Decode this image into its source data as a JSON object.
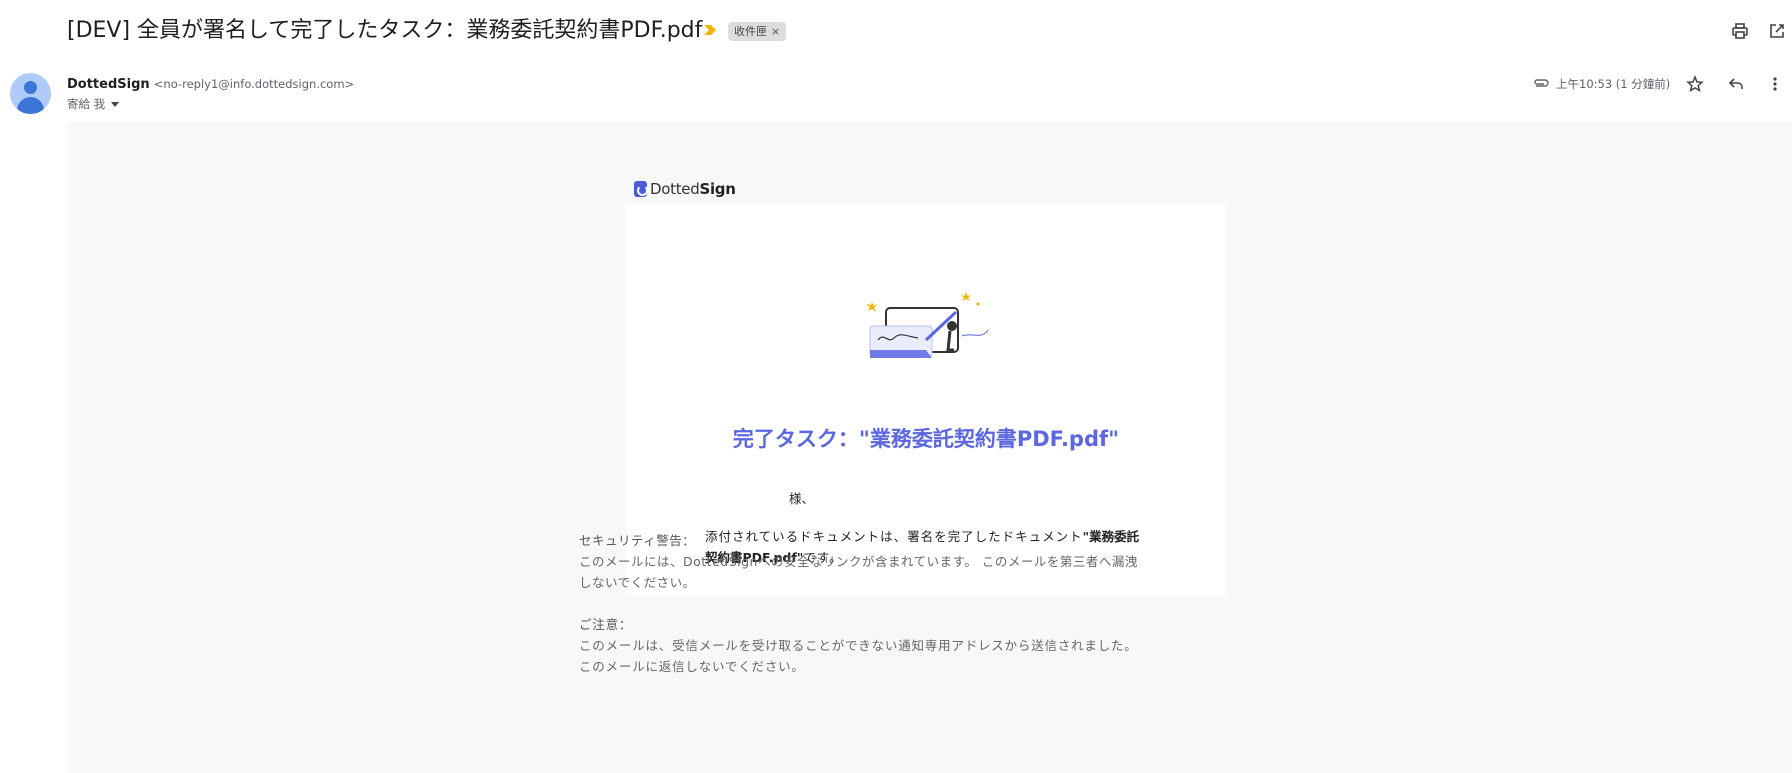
{
  "email": {
    "subject": "[DEV] 全員が署名して完了したタスク：業務委託契約書PDF.pdf",
    "label": "收件匣",
    "label_remove": "×",
    "sender_name": "DottedSign",
    "sender_email": "<no-reply1@info.dottedsign.com>",
    "recipient": "寄給 我",
    "time": "上午10:53 (1 分鐘前)"
  },
  "icons": {
    "importance": "importance-marker-icon",
    "print": "print-icon",
    "open_new_window": "open-in-new-window-icon",
    "attachment": "attachment-icon",
    "star": "star-icon",
    "reply": "reply-icon",
    "more": "more-vert-icon"
  },
  "colors": {
    "accent": "#5a67e0",
    "importance": "#f4b400",
    "avatar": "#aecbfa",
    "body_bg": "#f8f8f8"
  },
  "body": {
    "brand_light": "Dotted",
    "brand_bold": "Sign",
    "title": "完了タスク：\"業務委託契約書PDF.pdf\"",
    "greeting": "様、",
    "message_pre": "添付されているドキュメントは、署名を完了したドキュメント",
    "message_doc_line1": "\"業務委託",
    "message_doc_line2": "契約書PDF.pdf\"",
    "message_post": "です。",
    "security_heading": "セキュリティ警告：",
    "security_text": "このメールには、DottedSignへの安全なリンクが含まれています。 このメールを第三者へ漏洩しないでください。",
    "notice_heading": "ご注意：",
    "notice_line1": "このメールは、受信メールを受け取ることができない通知専用アドレスから送信されました。",
    "notice_line2": "このメールに返信しないでください。"
  }
}
